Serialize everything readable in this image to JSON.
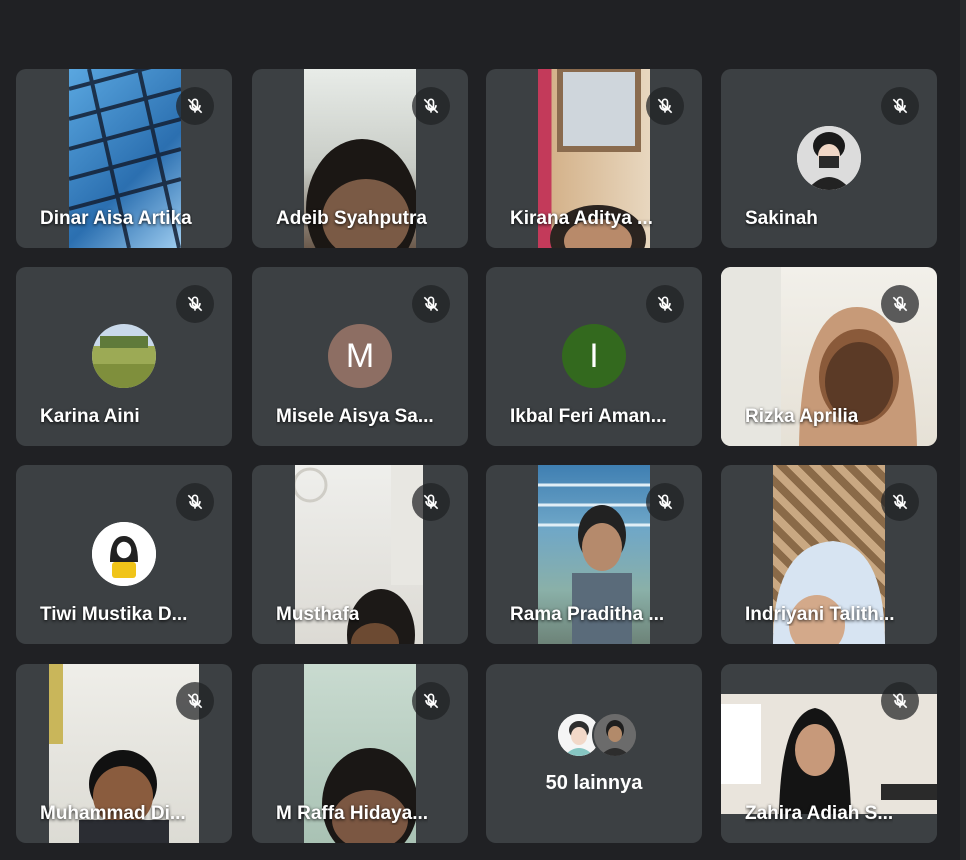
{
  "participants": [
    {
      "name": "Dinar Aisa Artika",
      "muted": true
    },
    {
      "name": "Adeib Syahputra",
      "muted": true
    },
    {
      "name": "Kirana Aditya ...",
      "muted": true
    },
    {
      "name": "Sakinah",
      "muted": true
    },
    {
      "name": "Karina Aini",
      "muted": true
    },
    {
      "name": "Misele Aisya Sa...",
      "muted": true,
      "avatar_letter": "M",
      "avatar_color": "#8d6e63"
    },
    {
      "name": "Ikbal Feri Aman...",
      "muted": true,
      "avatar_letter": "I",
      "avatar_color": "#33691e"
    },
    {
      "name": "Rizka Aprilia",
      "muted": true
    },
    {
      "name": "Tiwi Mustika D...",
      "muted": true
    },
    {
      "name": "Musthafa",
      "muted": true
    },
    {
      "name": "Rama Praditha ...",
      "muted": true
    },
    {
      "name": "Indriyani Talith...",
      "muted": true
    },
    {
      "name": "Muhammad Di...",
      "muted": true
    },
    {
      "name": "M Raffa Hidaya...",
      "muted": true
    },
    {
      "name": "Zahira Adiah S...",
      "muted": true
    }
  ],
  "overflow_tile": {
    "label": "50 lainnya"
  },
  "icons": {
    "mute": "mic-off-icon"
  },
  "colors": {
    "background": "#202124",
    "tile": "#3c4043"
  }
}
